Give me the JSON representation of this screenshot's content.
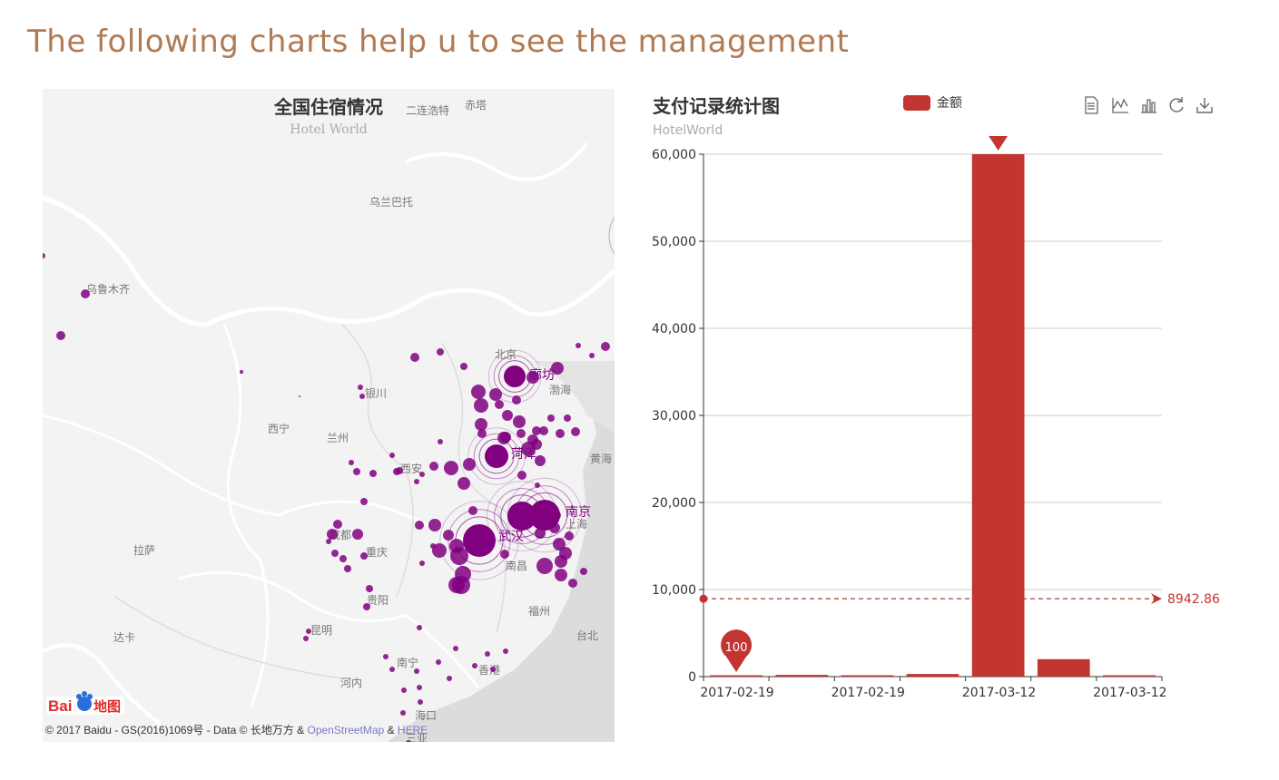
{
  "page": {
    "title": "The following charts help u to see the management"
  },
  "map": {
    "title": "全国住宿情况",
    "subtitle": "Hotel World",
    "logo_text": "Bai地图",
    "copyright_prefix": "© 2017 Baidu - GS(2016)1069号 - Data © 长地万方 &",
    "copyright_link1": "OpenStreetMap",
    "copyright_amp": "&",
    "copyright_link2": "HERE",
    "city_labels": [
      "二连浩特",
      "乌兰巴托",
      "乌鲁木齐",
      "北京",
      "廊坊",
      "渤海",
      "银川",
      "西宁",
      "兰州",
      "菏泽",
      "黄海",
      "西安",
      "成都",
      "重庆",
      "武汉",
      "南京",
      "上海",
      "南昌",
      "拉萨",
      "贵阳",
      "昆明",
      "南宁",
      "香港",
      "福州",
      "台北",
      "海口",
      "三亚",
      "河内",
      "达卡",
      "赤塔"
    ],
    "highlight_labels": [
      "廊坊",
      "菏泽",
      "南京",
      "武汉"
    ],
    "bubble_color": "#800080"
  },
  "chart": {
    "title": "支付记录统计图",
    "subtitle": "HotelWorld",
    "legend": {
      "label": "金额",
      "color": "#c23531"
    },
    "toolbox": [
      "data-view-icon",
      "line-chart-icon",
      "bar-chart-icon",
      "restore-icon",
      "download-icon"
    ],
    "mark_average": "8942.86",
    "mark_max_label": "60000",
    "mark_min_label": "100"
  },
  "chart_data": {
    "type": "bar",
    "title": "支付记录统计图",
    "subtitle": "HotelWorld",
    "categories": [
      "2017-02-19",
      "2017-02-19",
      "2017-02-19",
      "2017-02-19",
      "2017-03-12",
      "2017-03-12",
      "2017-03-12"
    ],
    "tick_labels": [
      "2017-02-19",
      "2017-02-19",
      "2017-03-12",
      "2017-03-12"
    ],
    "series": [
      {
        "name": "金额",
        "values": [
          100,
          200,
          100,
          300,
          60000,
          2000,
          100
        ]
      }
    ],
    "ylim": [
      0,
      60000
    ],
    "y_ticks": [
      "0",
      "10,000",
      "20,000",
      "30,000",
      "40,000",
      "50,000",
      "60,000"
    ],
    "average_line": 8942.86,
    "max_pin": 60000,
    "min_pin": 100,
    "grid": true,
    "legend_position": "top-center",
    "color": "#c23531"
  }
}
